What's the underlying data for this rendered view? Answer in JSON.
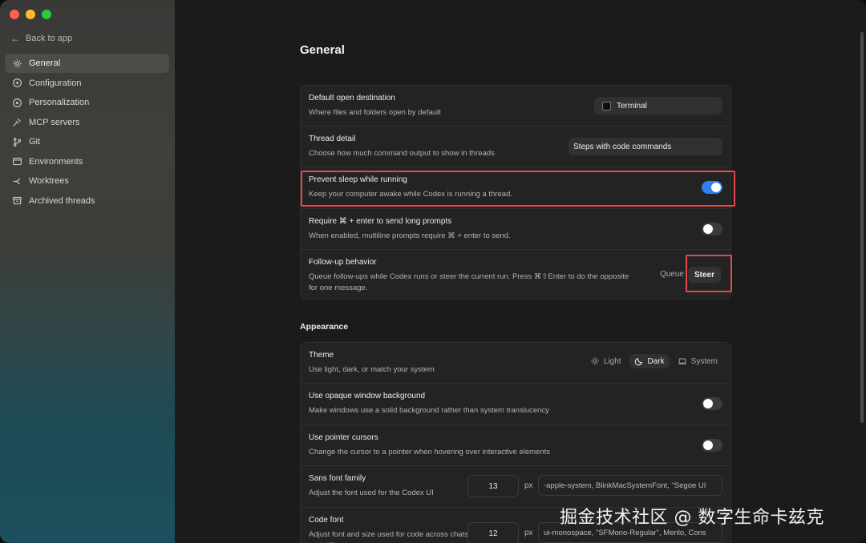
{
  "sidebar": {
    "back_label": "Back to app",
    "items": [
      {
        "label": "General",
        "icon": "gear-icon",
        "active": true
      },
      {
        "label": "Configuration",
        "icon": "sliders-icon"
      },
      {
        "label": "Personalization",
        "icon": "palette-icon"
      },
      {
        "label": "MCP servers",
        "icon": "plug-icon"
      },
      {
        "label": "Git",
        "icon": "git-branch-icon"
      },
      {
        "label": "Environments",
        "icon": "terminal-window-icon"
      },
      {
        "label": "Worktrees",
        "icon": "worktree-icon"
      },
      {
        "label": "Archived threads",
        "icon": "archive-icon"
      }
    ]
  },
  "main": {
    "title": "General",
    "general_rows": {
      "open_dest": {
        "label": "Default open destination",
        "desc": "Where files and folders open by default",
        "value": "Terminal"
      },
      "thread_detail": {
        "label": "Thread detail",
        "desc": "Choose how much command output to show in threads",
        "value": "Steps with code commands"
      },
      "prevent_sleep": {
        "label": "Prevent sleep while running",
        "desc": "Keep your computer awake while Codex is running a thread.",
        "enabled": true
      },
      "require_cmd": {
        "label": "Require ⌘ + enter to send long prompts",
        "desc": "When enabled, multiline prompts require ⌘ + enter to send.",
        "enabled": false
      },
      "followup": {
        "label": "Follow-up behavior",
        "desc": "Queue follow-ups while Codex runs or steer the current run. Press ⌘⇧Enter to do the opposite for one message.",
        "option_queue": "Queue",
        "option_steer": "Steer",
        "selected": "Steer"
      }
    },
    "appearance_title": "Appearance",
    "appearance_rows": {
      "theme": {
        "label": "Theme",
        "desc": "Use light, dark, or match your system",
        "options": [
          "Light",
          "Dark",
          "System"
        ],
        "selected": "Dark"
      },
      "opaque": {
        "label": "Use opaque window background",
        "desc": "Make windows use a solid background rather than system translucency",
        "enabled": false
      },
      "pointer": {
        "label": "Use pointer cursors",
        "desc": "Change the cursor to a pointer when hovering over interactive elements",
        "enabled": false
      },
      "sans_font": {
        "label": "Sans font family",
        "desc": "Adjust the font used for the Codex UI",
        "size": "13",
        "unit": "px",
        "family": "-apple-system, BlinkMacSystemFont, \"Segoe UI"
      },
      "code_font": {
        "label": "Code font",
        "desc": "Adjust font and size used for code across chats and diffs",
        "size": "12",
        "unit": "px",
        "family": "ui-monospace, \"SFMono-Regular\", Menlo, Cons"
      }
    }
  },
  "watermark": "掘金技术社区 @ 数字生命卡兹克",
  "colors": {
    "accent": "#2f7ff0",
    "highlight": "#e5484d"
  }
}
